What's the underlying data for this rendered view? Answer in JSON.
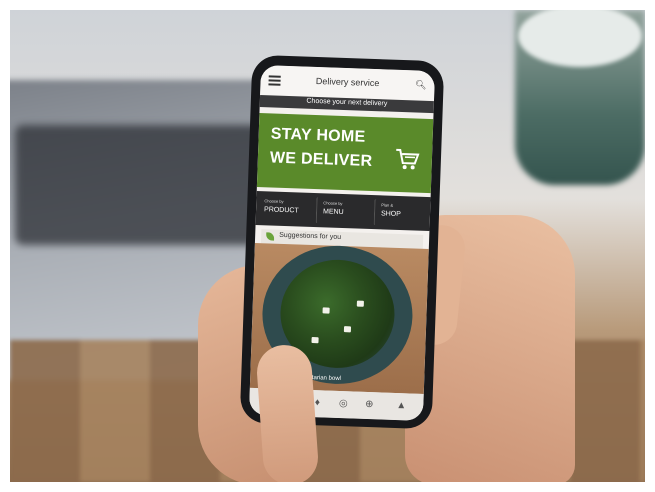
{
  "app": {
    "title": "Delivery service",
    "subtitle": "Choose your next delivery"
  },
  "banner": {
    "line1": "STAY HOME",
    "line2": "WE DELIVER",
    "color": "#5a8a2a"
  },
  "nav_row": [
    {
      "small": "Choose by",
      "big": "PRODUCT"
    },
    {
      "small": "Choose by",
      "big": "MENU"
    },
    {
      "small": "Plan &",
      "big": "SHOP"
    }
  ],
  "suggestions": {
    "label": "Suggestions for you"
  },
  "food_card": {
    "caption": "Vegetarian bowl"
  },
  "icons": {
    "menu": "hamburger-menu-icon",
    "search": "search-icon",
    "cart": "shopping-cart-icon",
    "leaf": "leaf-icon",
    "bottom_nav": [
      "food-icon",
      "home-icon",
      "add-icon",
      "profile-icon"
    ]
  }
}
